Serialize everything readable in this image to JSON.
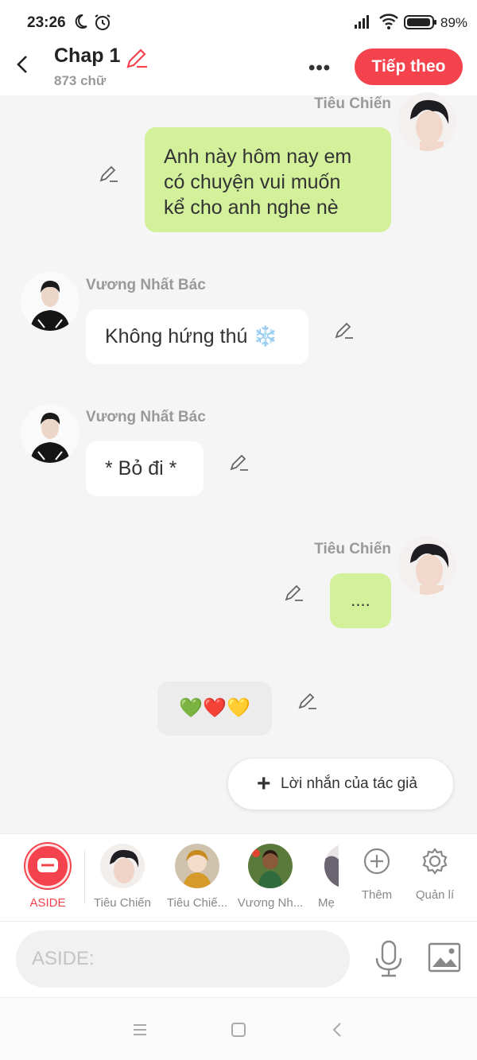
{
  "status": {
    "time": "23:26",
    "battery": "89%"
  },
  "header": {
    "title": "Chap 1",
    "word_count": "873 chữ",
    "more": "•••",
    "next_label": "Tiếp theo"
  },
  "messages": [
    {
      "sender": "Tiêu Chiến",
      "side": "right",
      "text": "Anh này hôm nay em\ncó chuyện vui muốn\nkể cho anh nghe nè"
    },
    {
      "sender": "Vương Nhất Bác",
      "side": "left",
      "text": "Không hứng thú ❄️"
    },
    {
      "sender": "Vương Nhất Bác",
      "side": "left",
      "text": "* Bỏ đi *"
    },
    {
      "sender": "Tiêu Chiến",
      "side": "right",
      "text": "...."
    },
    {
      "sender": "",
      "side": "center",
      "text": "💚❤️💛"
    }
  ],
  "author_note_label": "Lời nhắn của tác giả",
  "characters": [
    {
      "label": "ASIDE"
    },
    {
      "label": "Tiêu Chiến"
    },
    {
      "label": "Tiêu Chiế..."
    },
    {
      "label": "Vương Nh..."
    },
    {
      "label": "Mẹ"
    }
  ],
  "actions": {
    "add_label": "Thêm",
    "manage_label": "Quản lí"
  },
  "input": {
    "placeholder": "ASIDE:"
  },
  "colors": {
    "accent": "#f4434d",
    "right_bubble": "#d3f09b",
    "left_bubble": "#ffffff"
  }
}
